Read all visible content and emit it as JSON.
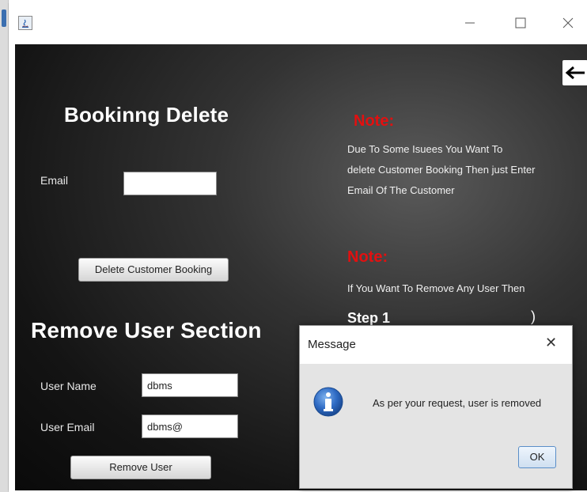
{
  "booking_section": {
    "title": "Bookinng Delete",
    "email_label": "Email",
    "email_value": "",
    "delete_button": "Delete Customer Booking"
  },
  "remove_section": {
    "title": "Remove User Section",
    "username_label": "User Name",
    "username_value": "dbms",
    "useremail_label": "User Email",
    "useremail_value": "dbms@",
    "remove_button": "Remove User"
  },
  "notes": {
    "note1_heading": "Note:",
    "note1_lines": [
      "Due To Some Isuees You Want To",
      "delete Customer Booking Then just Enter",
      "Email Of The Customer"
    ],
    "note2_heading": "Note:",
    "note2_line": "If You Want To Remove Any  User Then",
    "step": "Step 1"
  },
  "dialog": {
    "title": "Message",
    "message": "As per your request,  user is removed",
    "ok_label": "OK",
    "close_glyph": "✕"
  },
  "colors": {
    "note_red": "#e21010",
    "background_dark": "#141414",
    "info_blue": "#2f6bc4"
  },
  "icons": [
    "java-app-icon",
    "minimize-icon",
    "maximize-icon",
    "close-icon",
    "back-arrow-icon",
    "info-icon",
    "dialog-close-icon"
  ]
}
